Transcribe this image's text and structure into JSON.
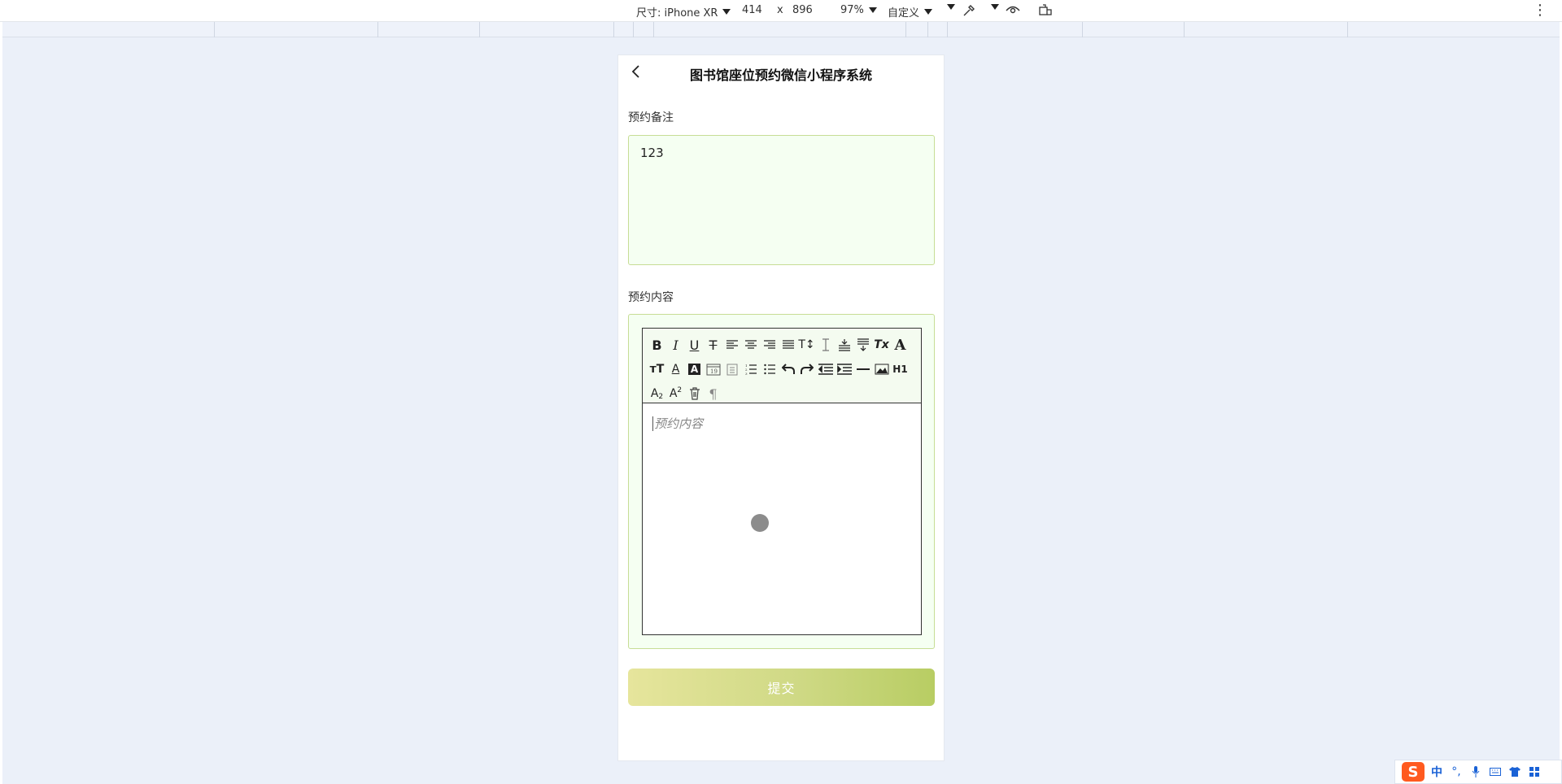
{
  "devtools": {
    "device_label": "尺寸: iPhone XR",
    "width": "414",
    "times": "x",
    "height": "896",
    "zoom": "97%",
    "throttle": "自定义"
  },
  "page": {
    "title": "图书馆座位预约微信小程序系统",
    "remark_label": "预约备注",
    "remark_value": "123",
    "content_label": "预约内容",
    "content_placeholder": "预约内容",
    "submit_label": "提交"
  },
  "editor_toolbar": {
    "row1": [
      "B",
      "I",
      "U",
      "S",
      "align-left",
      "align-center",
      "align-right",
      "align-justify",
      "TI",
      "line-height",
      "paragraph-spacing",
      "block-spacing",
      "Tx",
      "A"
    ],
    "row2": [
      "font-size",
      "font-color",
      "A",
      "date",
      "time",
      "ordered-list",
      "bullet-list",
      "undo",
      "redo",
      "outdent",
      "indent",
      "hr",
      "image",
      "H1"
    ],
    "row3": [
      "A2sub",
      "A2sup",
      "delete",
      "pilcrow"
    ],
    "h1_text": "H1",
    "tx_text": "Tx"
  },
  "ime": {
    "logo": "S",
    "mode": "中"
  },
  "colors": {
    "canvas_bg": "#ebf0f9",
    "field_bg": "#f5fff2",
    "field_border": "#c7dd95",
    "button_start": "#e6e59c",
    "button_end": "#b8cd63"
  }
}
